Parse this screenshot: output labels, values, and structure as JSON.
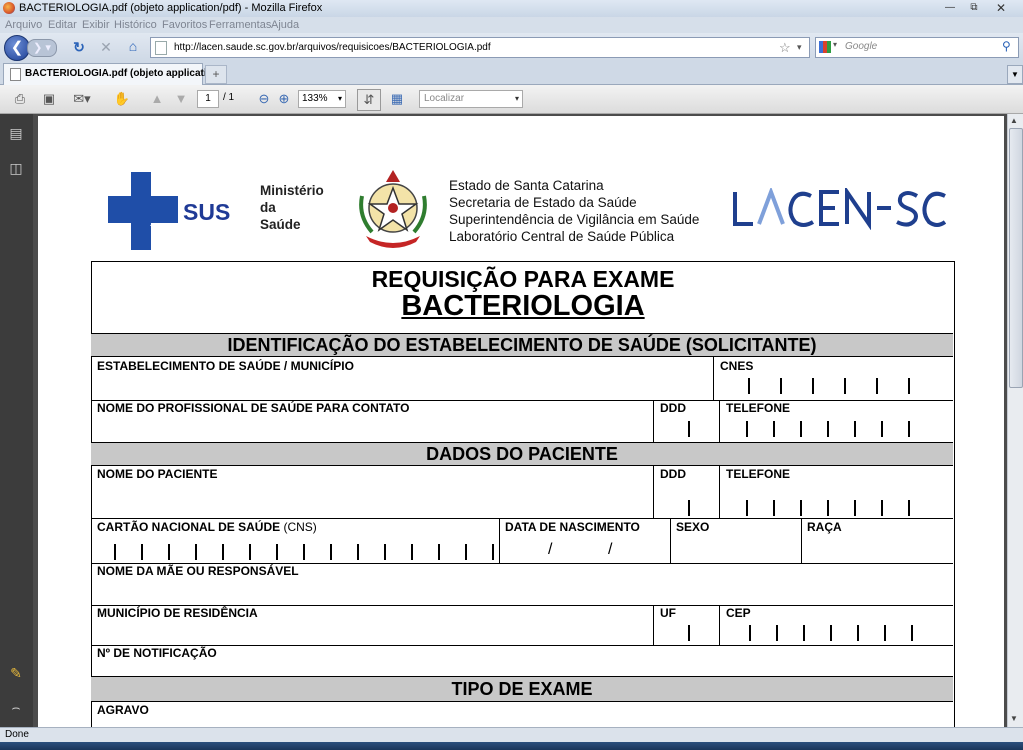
{
  "window": {
    "title": "BACTERIOLOGIA.pdf (objeto application/pdf) - Mozilla Firefox"
  },
  "menu": [
    "Arquivo",
    "Editar",
    "Exibir",
    "Histórico",
    "Favoritos",
    "Ferramentas",
    "Ajuda"
  ],
  "nav": {
    "url": "http://lacen.saude.sc.gov.br/arquivos/requisicoes/BACTERIOLOGIA.pdf",
    "search_placeholder": "Google"
  },
  "tab": {
    "label": "BACTERIOLOGIA.pdf (objeto applicati..."
  },
  "pdf_toolbar": {
    "page_current": "1",
    "page_total": "/ 1",
    "zoom": "133%",
    "find_placeholder": "Localizar"
  },
  "status": {
    "text": "Done"
  },
  "document": {
    "sus_text": "SUS",
    "ministry": [
      "Ministério",
      "da",
      "Saúde"
    ],
    "state_lines": [
      "Estado de Santa Catarina",
      "Secretaria de Estado da Saúde",
      "Superintendência de Vigilância em Saúde",
      "Laboratório Central de Saúde Pública"
    ],
    "lacen_logo": "LACEN-SC",
    "title1": "REQUISIÇÃO PARA EXAME",
    "title2": "BACTERIOLOGIA",
    "section_solicitante": "IDENTIFICAÇÃO DO ESTABELECIMENTO DE SAÚDE (SOLICITANTE)",
    "estabelecimento": "ESTABELECIMENTO DE SAÚDE / MUNICÍPIO",
    "cnes": "CNES",
    "profissional": "NOME DO PROFISSIONAL DE SAÚDE PARA CONTATO",
    "ddd": "DDD",
    "telefone": "TELEFONE",
    "section_paciente": "DADOS DO PACIENTE",
    "nome_paciente": "NOME DO PACIENTE",
    "cns": "CARTÃO NACIONAL DE SAÚDE",
    "cns_abbr": "(CNS)",
    "data_nasc": "DATA DE NASCIMENTO",
    "date_sep": "/",
    "sexo": "SEXO",
    "raca": "RAÇA",
    "mae": "NOME DA MÃE OU RESPONSÁVEL",
    "municipio": "MUNICÍPIO DE RESIDÊNCIA",
    "uf": "UF",
    "cep": "CEP",
    "notificacao": "Nº DE NOTIFICAÇÃO",
    "section_tipo": "TIPO DE EXAME",
    "agravo": "AGRAVO"
  }
}
